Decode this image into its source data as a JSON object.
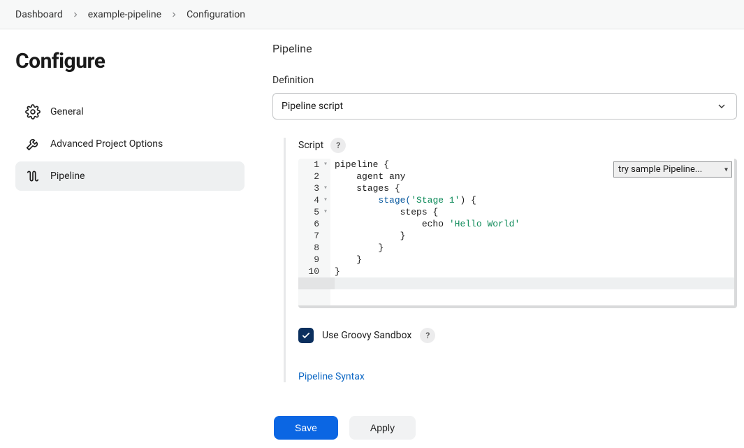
{
  "breadcrumb": {
    "items": [
      "Dashboard",
      "example-pipeline",
      "Configuration"
    ]
  },
  "sidebar": {
    "title": "Configure",
    "items": [
      {
        "label": "General",
        "icon": "gear-icon"
      },
      {
        "label": "Advanced Project Options",
        "icon": "wrench-icon"
      },
      {
        "label": "Pipeline",
        "icon": "pipeline-icon"
      }
    ],
    "active_index": 2
  },
  "main": {
    "section_title": "Pipeline",
    "definition_label": "Definition",
    "definition_value": "Pipeline script"
  },
  "script": {
    "label": "Script",
    "help_glyph": "?",
    "sample_dropdown": "try sample Pipeline...",
    "line_count": 11,
    "fold_lines": [
      1,
      3,
      4,
      5
    ],
    "current_line": 11,
    "lines": [
      {
        "indent": 0,
        "segments": [
          {
            "t": "pipeline {",
            "c": "tok-kw"
          }
        ]
      },
      {
        "indent": 1,
        "segments": [
          {
            "t": "agent any",
            "c": "tok-kw"
          }
        ]
      },
      {
        "indent": 1,
        "segments": [
          {
            "t": "stages {",
            "c": "tok-kw"
          }
        ]
      },
      {
        "indent": 2,
        "segments": [
          {
            "t": "stage(",
            "c": "tok-fn"
          },
          {
            "t": "'Stage 1'",
            "c": "tok-str"
          },
          {
            "t": ") {",
            "c": "tok-kw"
          }
        ]
      },
      {
        "indent": 3,
        "segments": [
          {
            "t": "steps {",
            "c": "tok-kw"
          }
        ]
      },
      {
        "indent": 4,
        "segments": [
          {
            "t": "echo ",
            "c": "tok-kw"
          },
          {
            "t": "'Hello World'",
            "c": "tok-str"
          }
        ]
      },
      {
        "indent": 3,
        "segments": [
          {
            "t": "}",
            "c": "tok-kw"
          }
        ]
      },
      {
        "indent": 2,
        "segments": [
          {
            "t": "}",
            "c": "tok-kw"
          }
        ]
      },
      {
        "indent": 1,
        "segments": [
          {
            "t": "}",
            "c": "tok-kw"
          }
        ]
      },
      {
        "indent": 0,
        "segments": [
          {
            "t": "}",
            "c": "tok-kw"
          }
        ]
      },
      {
        "indent": 0,
        "segments": []
      }
    ]
  },
  "sandbox": {
    "checked": true,
    "label": "Use Groovy Sandbox",
    "help_glyph": "?"
  },
  "links": {
    "pipeline_syntax": "Pipeline Syntax"
  },
  "footer": {
    "save_label": "Save",
    "apply_label": "Apply"
  }
}
